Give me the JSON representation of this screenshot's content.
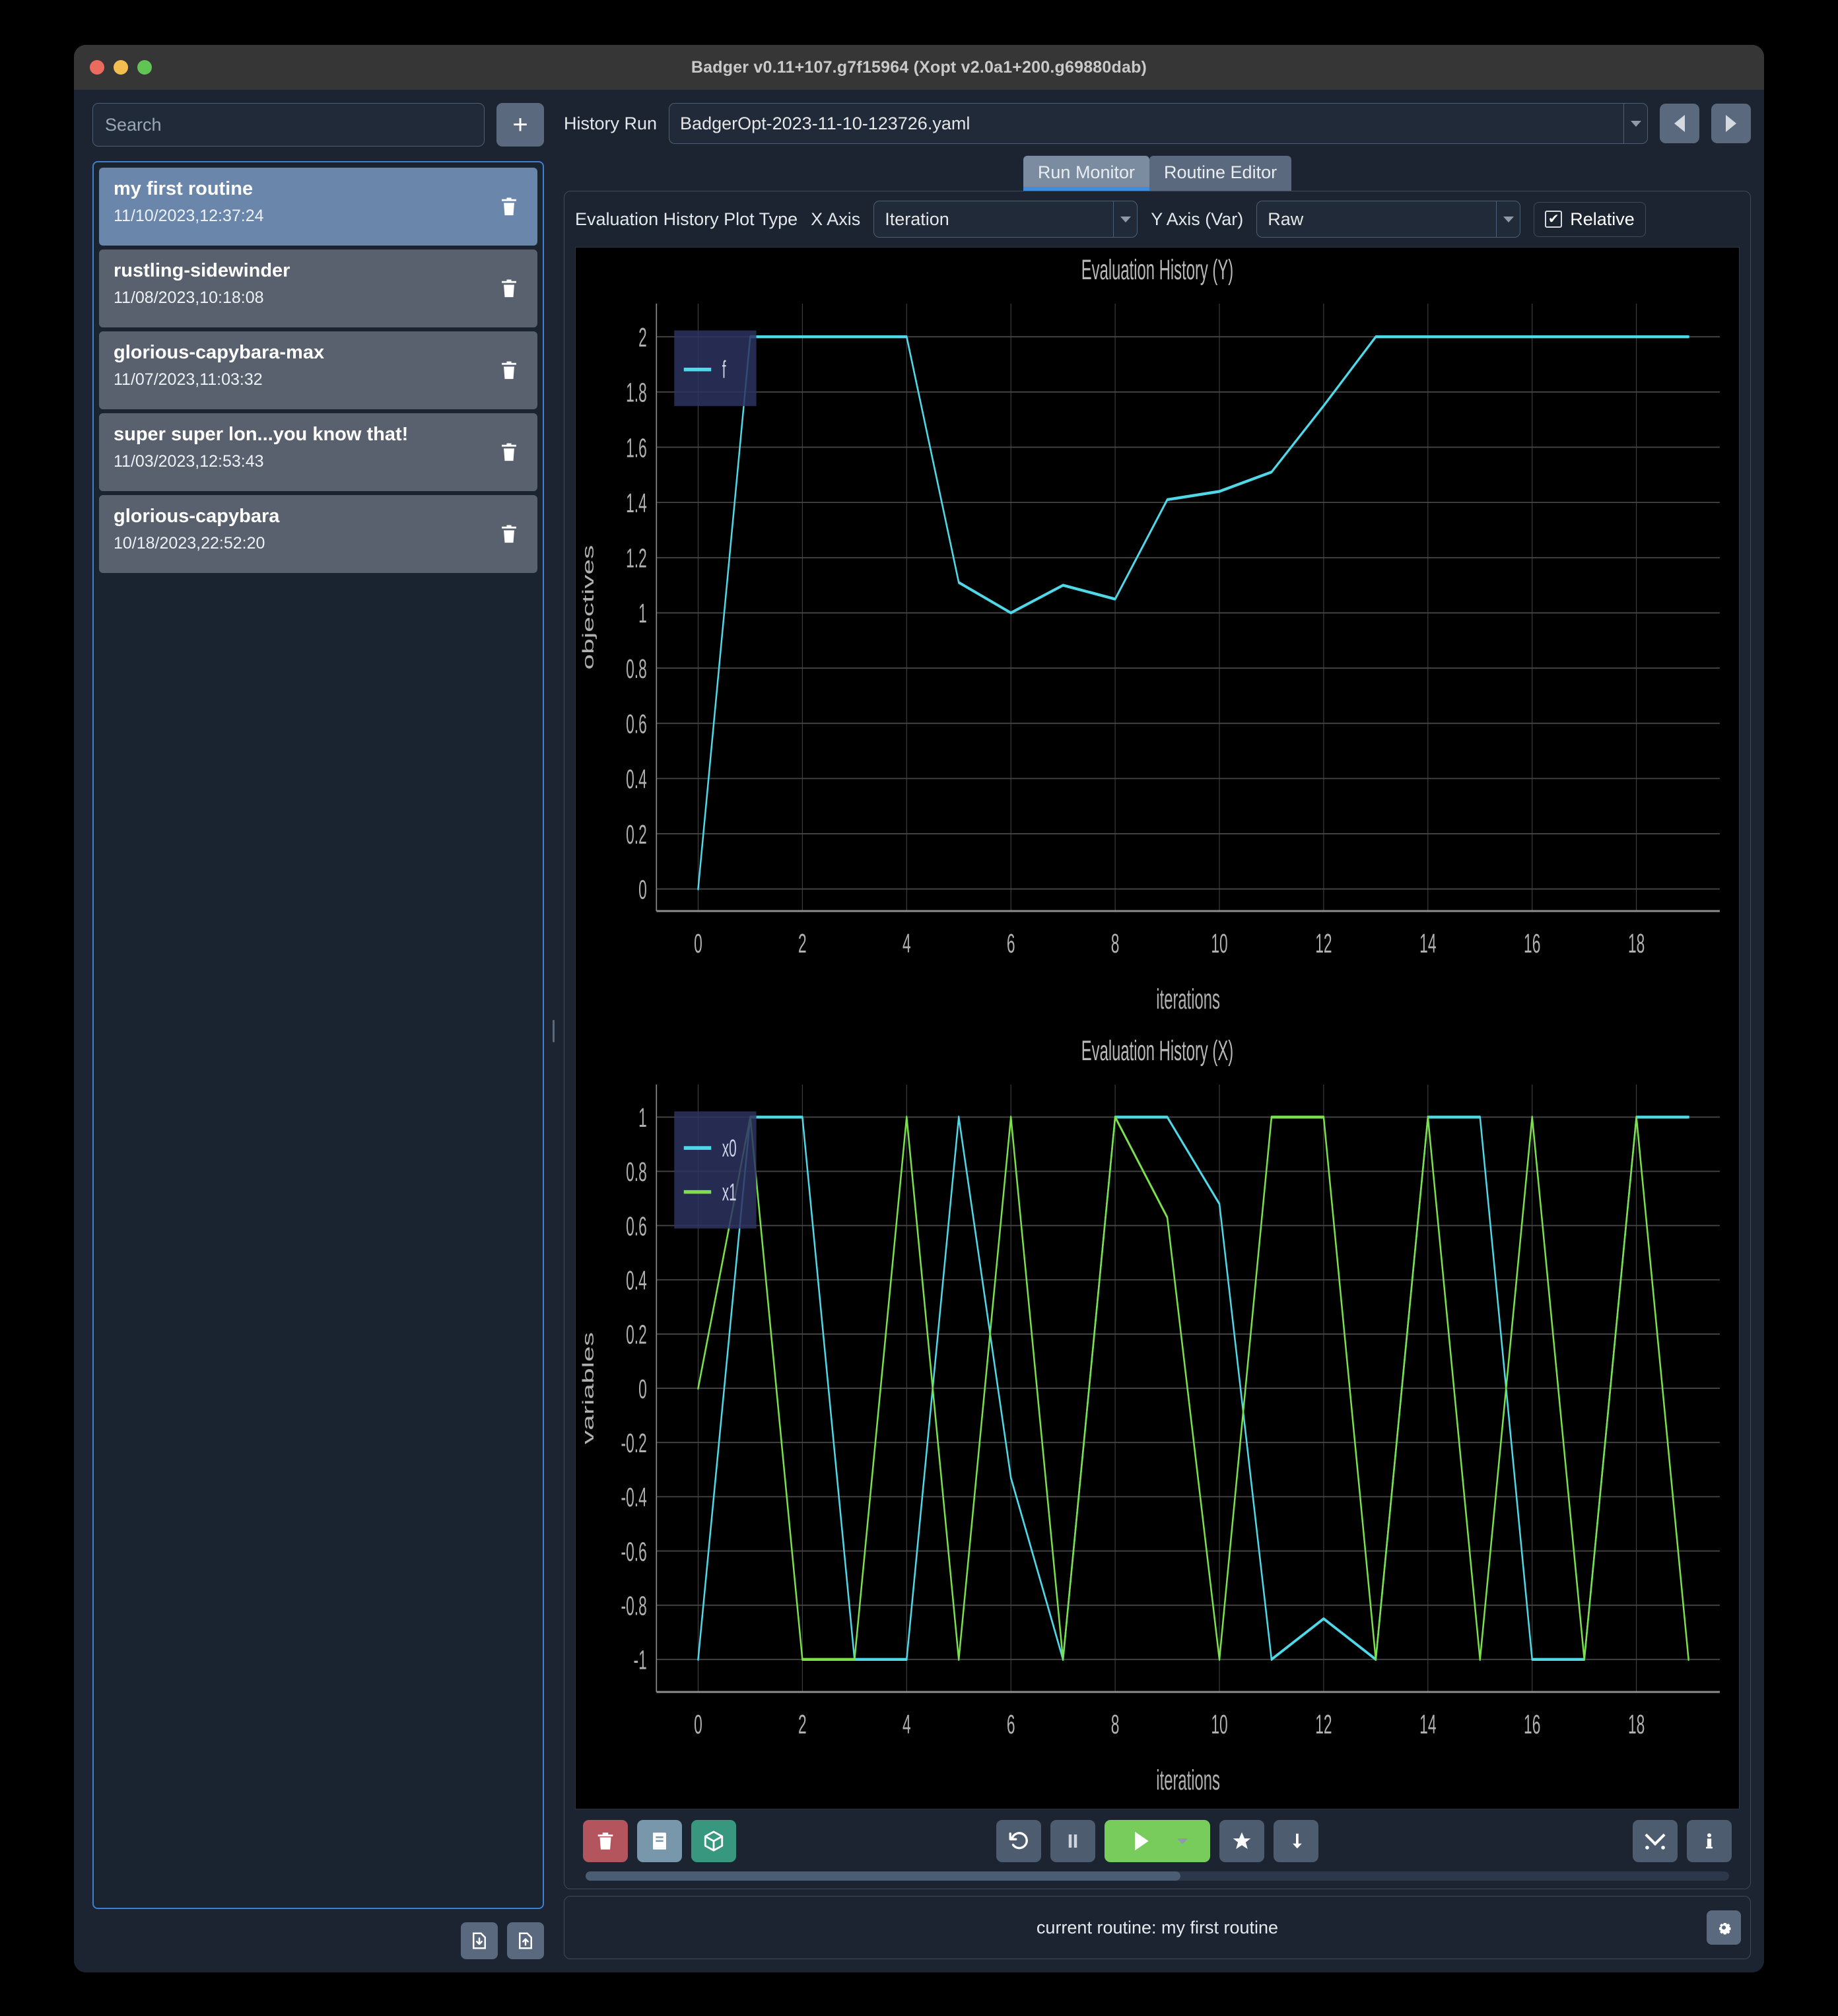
{
  "window": {
    "title": "Badger v0.11+107.g7f15964 (Xopt v2.0a1+200.g69880dab)",
    "traffic_colors": {
      "close": "#ed6a5e",
      "minimize": "#f4bd4f",
      "zoom": "#61c554"
    }
  },
  "sidebar": {
    "search_placeholder": "Search",
    "search_value": "",
    "add_label": "+",
    "routines": [
      {
        "name": "my first routine",
        "date": "11/10/2023,12:37:24",
        "selected": true
      },
      {
        "name": "rustling-sidewinder",
        "date": "11/08/2023,10:18:08",
        "selected": false
      },
      {
        "name": "glorious-capybara-max",
        "date": "11/07/2023,11:03:32",
        "selected": false
      },
      {
        "name": "super super lon...you know that!",
        "date": "11/03/2023,12:53:43",
        "selected": false
      },
      {
        "name": "glorious-capybara",
        "date": "10/18/2023,22:52:20",
        "selected": false
      }
    ],
    "footer_buttons": [
      {
        "icon": "import-routine-icon"
      },
      {
        "icon": "export-routine-icon"
      }
    ]
  },
  "main": {
    "history_label": "History Run",
    "history_value": "BadgerOpt-2023-11-10-123726.yaml",
    "prev_icon": "chevron-left-icon",
    "next_icon": "chevron-right-icon",
    "tabs": [
      {
        "label": "Run Monitor",
        "active": true
      },
      {
        "label": "Routine Editor",
        "active": false
      }
    ],
    "controls": {
      "plot_type_label": "Evaluation History Plot Type",
      "x_axis_label": "X Axis",
      "x_axis_value": "Iteration",
      "y_axis_label": "Y Axis (Var)",
      "y_axis_value": "Raw",
      "relative_label": "Relative",
      "relative_checked": true,
      "checkmark": "✔"
    },
    "toolbar": {
      "left": [
        {
          "name": "delete-run-button",
          "icon": "trash-icon",
          "color": "#b4555d"
        },
        {
          "name": "logbook-button",
          "icon": "book-icon",
          "color": "#7897ab"
        },
        {
          "name": "archive-button",
          "icon": "box-icon",
          "color": "#37977f"
        }
      ],
      "center": [
        {
          "name": "reset-button",
          "icon": "reset-icon"
        },
        {
          "name": "pause-button",
          "icon": "pause-icon"
        },
        {
          "name": "run-button",
          "icon": "play-icon",
          "color": "#78cc5b"
        },
        {
          "name": "optimal-button",
          "icon": "star-icon"
        },
        {
          "name": "jump-button",
          "icon": "arrow-down-icon"
        }
      ],
      "right": [
        {
          "name": "tools-button",
          "icon": "tools-icon"
        },
        {
          "name": "info-button",
          "icon": "info-icon"
        }
      ]
    },
    "status_text": "current routine: my first routine",
    "settings_icon": "gear-icon"
  },
  "chart_data": [
    {
      "type": "line",
      "title": "Evaluation History (Y)",
      "xlabel": "iterations",
      "ylabel": "objectives",
      "xlim": [
        -0.8,
        19.6
      ],
      "ylim": [
        -0.08,
        2.12
      ],
      "xticks": [
        0,
        2,
        4,
        6,
        8,
        10,
        12,
        14,
        16,
        18
      ],
      "yticks": [
        0,
        0.2,
        0.4,
        0.6,
        0.8,
        1,
        1.2,
        1.4,
        1.6,
        1.8,
        2
      ],
      "grid": true,
      "legend_position": "top-left",
      "series": [
        {
          "name": "f",
          "color": "#4fd8e8",
          "x": [
            0,
            1,
            2,
            3,
            4,
            5,
            6,
            7,
            8,
            9,
            10,
            11,
            12,
            13,
            14,
            15,
            16,
            17,
            18,
            19
          ],
          "values": [
            0,
            2,
            2,
            2,
            2,
            1.11,
            1.0,
            1.1,
            1.05,
            1.41,
            1.44,
            1.51,
            1.75,
            2,
            2,
            2,
            2,
            2,
            2,
            2
          ]
        }
      ]
    },
    {
      "type": "line",
      "title": "Evaluation History (X)",
      "xlabel": "iterations",
      "ylabel": "variables",
      "xlim": [
        -0.8,
        19.6
      ],
      "ylim": [
        -1.12,
        1.12
      ],
      "xticks": [
        0,
        2,
        4,
        6,
        8,
        10,
        12,
        14,
        16,
        18
      ],
      "yticks": [
        1,
        0.8,
        0.6,
        0.4,
        0.2,
        0,
        -0.2,
        -0.4,
        -0.6,
        -0.8,
        -1
      ],
      "grid": true,
      "legend_position": "top-left",
      "series": [
        {
          "name": "x0",
          "color": "#4fd8e8",
          "x": [
            0,
            1,
            2,
            3,
            4,
            5,
            6,
            7,
            8,
            9,
            10,
            11,
            12,
            13,
            14,
            15,
            16,
            17,
            18,
            19
          ],
          "values": [
            -1,
            1,
            1,
            -1,
            -1,
            1,
            -0.33,
            -1,
            1,
            1,
            0.68,
            -1,
            -0.85,
            -1,
            1,
            1,
            -1,
            -1,
            1,
            1
          ]
        },
        {
          "name": "x1",
          "color": "#7ae04b",
          "x": [
            0,
            1,
            2,
            3,
            4,
            5,
            6,
            7,
            8,
            9,
            10,
            11,
            12,
            13,
            14,
            15,
            16,
            17,
            18,
            19
          ],
          "values": [
            0,
            1,
            -1,
            -1,
            1,
            -1,
            1,
            -1,
            1,
            0.63,
            -1,
            1,
            1,
            -1,
            1,
            -1,
            1,
            -1,
            1,
            -1
          ]
        }
      ]
    }
  ]
}
